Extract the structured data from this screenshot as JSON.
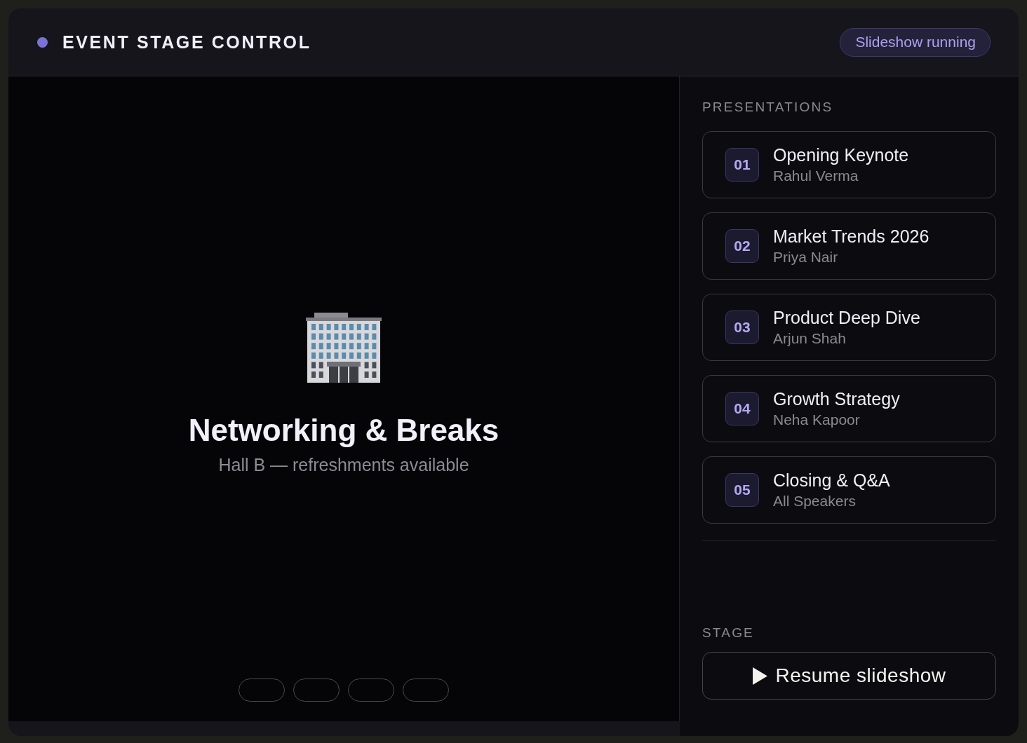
{
  "header": {
    "title": "EVENT STAGE CONTROL",
    "status_badge": "Slideshow running"
  },
  "stage": {
    "slide": {
      "title": "Networking & Breaks",
      "subtitle": "Hall B — refreshments available"
    },
    "slide_indicators": [
      {
        "selected": false
      },
      {
        "selected": false
      },
      {
        "selected": false
      },
      {
        "selected": false
      }
    ]
  },
  "sidebar": {
    "presentations_heading": "PRESENTATIONS",
    "presentations": [
      {
        "number": "01",
        "title": "Opening Keynote",
        "speaker": "Rahul Verma",
        "selected": false
      },
      {
        "number": "02",
        "title": "Market Trends 2026",
        "speaker": "Priya Nair",
        "selected": false
      },
      {
        "number": "03",
        "title": "Product Deep Dive",
        "speaker": "Arjun Shah",
        "selected": false
      },
      {
        "number": "04",
        "title": "Growth Strategy",
        "speaker": "Neha Kapoor",
        "selected": false
      },
      {
        "number": "05",
        "title": "Closing & Q&A",
        "speaker": "All Speakers",
        "selected": false
      }
    ],
    "stage_heading": "STAGE",
    "resume_button": "Resume slideshow"
  }
}
